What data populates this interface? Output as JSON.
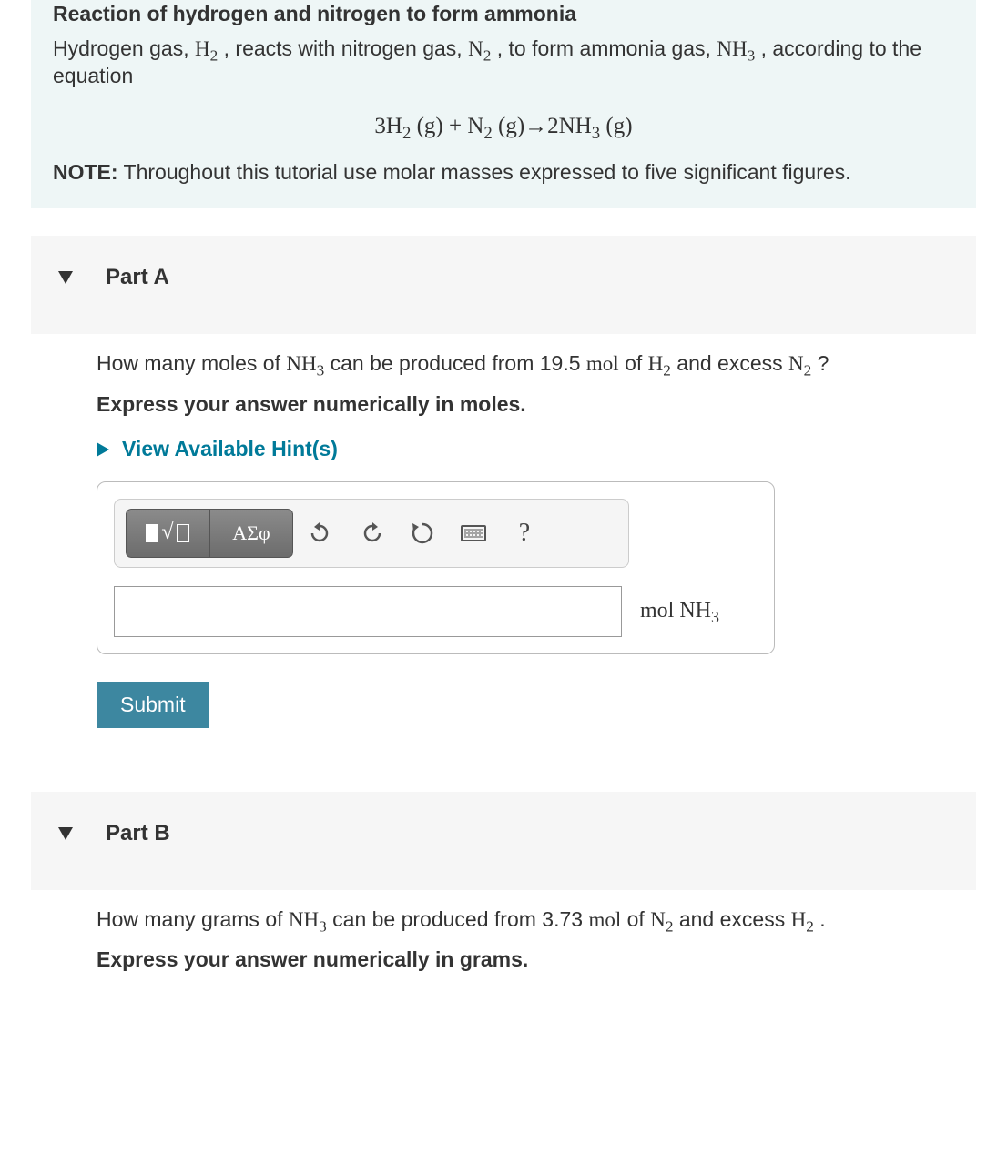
{
  "intro": {
    "title": "Reaction of hydrogen and nitrogen to form ammonia",
    "para_before_h2": "Hydrogen gas, ",
    "h2": "H",
    "para_between_1": " , reacts with nitrogen gas, ",
    "n2": "N",
    "para_between_2": " , to form ammonia gas, ",
    "nh3": "NH",
    "para_after": " , according to the equation",
    "equation": "3H₂ (g) + N₂ (g)→2NH₃ (g)",
    "note_label": "NOTE:",
    "note_text": "  Throughout this tutorial use molar masses expressed to five significant figures."
  },
  "partA": {
    "title": "Part A",
    "q_pre": "How many moles of ",
    "q_mid1": " can be produced from 19.5 ",
    "mol": "mol",
    "q_mid2": " of ",
    "q_mid3": " and excess ",
    "q_end": " ?",
    "instruct": "Express your answer numerically in moles.",
    "hint": "View Available Hint(s)",
    "greek_btn": "ΑΣφ",
    "help": "?",
    "unit_pre": "mol ",
    "submit": "Submit"
  },
  "partB": {
    "title": "Part B",
    "q_pre": "How many grams of ",
    "q_mid1": " can be produced from 3.73 ",
    "mol": "mol",
    "q_mid2": " of ",
    "q_mid3": " and excess ",
    "q_end": " .",
    "instruct": "Express your answer numerically in grams."
  }
}
